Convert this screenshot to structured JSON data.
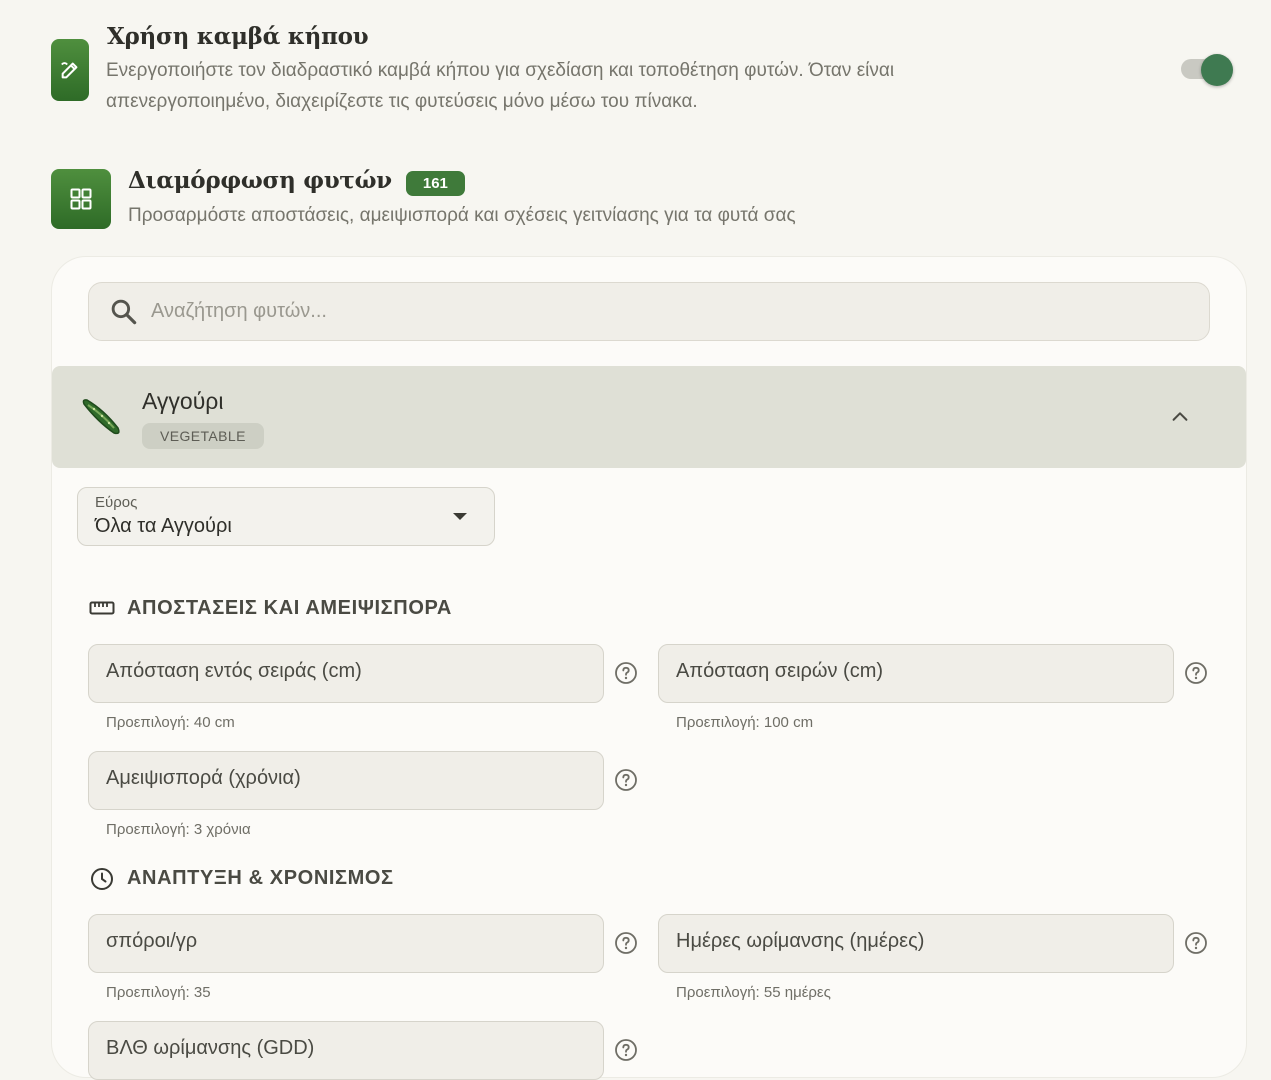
{
  "canvas_setting": {
    "title": "Χρήση καμβά κήπου",
    "description_line1": "Ενεργοποιήστε τον διαδραστικό καμβά κήπου για σχεδίαση και τοποθέτηση φυτών. Όταν είναι",
    "description_line2": "απενεργοποιημένο, διαχειρίζεστε τις φυτεύσεις μόνο μέσω του πίνακα.",
    "toggle_on": true,
    "icon": "pencil-edit-icon"
  },
  "plant_config": {
    "title": "Διαμόρφωση φυτών",
    "count": "161",
    "description": "Προσαρμόστε αποστάσεις, αμειψισπορά και σχέσεις γειτνίασης για τα φυτά σας",
    "icon": "grid-icon"
  },
  "search": {
    "placeholder": "Αναζήτηση φυτών..."
  },
  "plant": {
    "name": "Αγγούρι",
    "category": "VEGETABLE",
    "icon": "cucumber-icon",
    "expanded": true
  },
  "scope": {
    "label": "Εύρος",
    "value": "Όλα τα Αγγούρι"
  },
  "sections": {
    "spacing": {
      "title": "ΑΠΟΣΤΑΣΕΙΣ ΚΑΙ ΑΜΕΙΨΙΣΠΟΡΑ",
      "fields": [
        {
          "label": "Απόσταση εντός σειράς (cm)",
          "hint": "Προεπιλογή: 40 cm"
        },
        {
          "label": "Απόσταση σειρών (cm)",
          "hint": "Προεπιλογή: 100 cm"
        },
        {
          "label": "Αμειψισπορά (χρόνια)",
          "hint": "Προεπιλογή: 3 χρόνια"
        }
      ]
    },
    "growth": {
      "title": "ΑΝΑΠΤΥΞΗ & ΧΡΟΝΙΣΜΟΣ",
      "fields": [
        {
          "label": "σπόροι/γρ",
          "hint": "Προεπιλογή: 35"
        },
        {
          "label": "Ημέρες ωρίμανσης (ημέρες)",
          "hint": "Προεπιλογή: 55 ημέρες"
        },
        {
          "label": "ΒΛΘ ωρίμανσης (GDD)"
        }
      ]
    }
  },
  "colors": {
    "accent_green": "#3f7a3a",
    "toggle_knob": "#3f7a51",
    "background": "#f7f6f1"
  }
}
